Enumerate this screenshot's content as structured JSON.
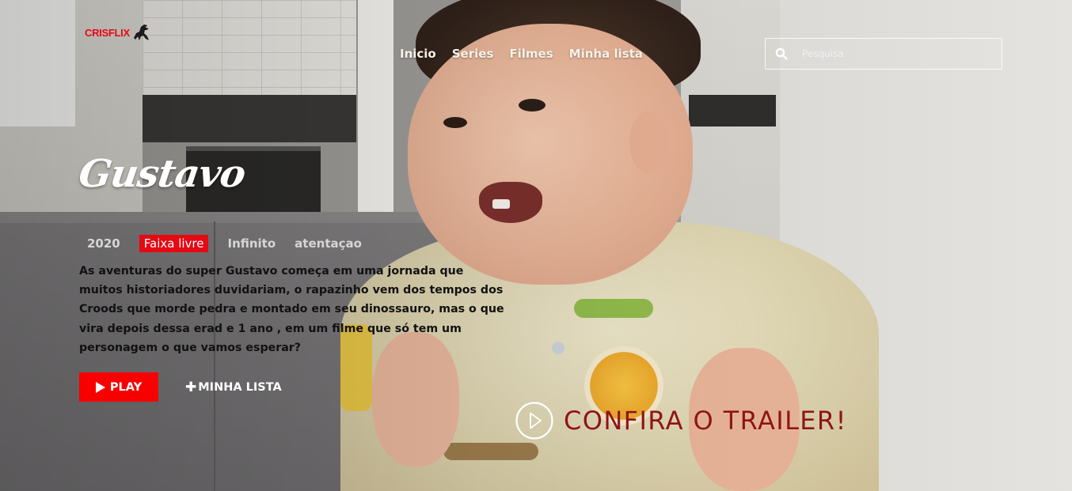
{
  "brand": {
    "name": "CRISFLIX",
    "color": "#e50914"
  },
  "nav": {
    "items": [
      {
        "label": "Inicio"
      },
      {
        "label": "Series"
      },
      {
        "label": "Filmes"
      },
      {
        "label": "Minha lista"
      }
    ]
  },
  "search": {
    "placeholder": "Pesquisa",
    "icon": "search-icon"
  },
  "hero": {
    "title": "Gustavo",
    "meta": {
      "year": "2020",
      "rating": "Faixa livre",
      "duration": "Infinito",
      "genre": "atentaçao"
    },
    "description": "As aventuras do super Gustavo começa em uma jornada que muitos historiadores duvidariam, o rapazinho vem dos tempos dos Croods que morde pedra e montado em seu dinossauro, mas o que vira depois dessa erad e 1 ano , em um filme que só tem um personagem o que vamos esperar?",
    "play_label": "PLAY",
    "list_label": "MINHA LISTA",
    "trailer_label": "CONFIRA O TRAILER!",
    "accent_color": "#f80000"
  }
}
